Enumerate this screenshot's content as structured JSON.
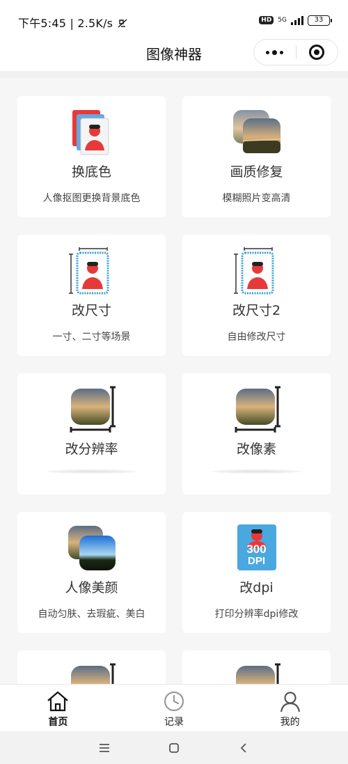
{
  "status_bar": {
    "time": "下午5:45",
    "speed": "2.5K/s",
    "hd": "HD",
    "network": "5G",
    "battery": "33"
  },
  "header": {
    "title": "图像神器"
  },
  "cards": [
    {
      "title": "换底色",
      "subtitle": "人像抠图更换背景底色",
      "icon": "id-photo-bg-icon"
    },
    {
      "title": "画质修复",
      "subtitle": "模糊照片变高清",
      "icon": "photo-restore-icon"
    },
    {
      "title": "改尺寸",
      "subtitle": "一寸、二寸等场景",
      "icon": "id-photo-resize-icon"
    },
    {
      "title": "改尺寸2",
      "subtitle": "自由修改尺寸",
      "icon": "id-photo-resize-icon"
    },
    {
      "title": "改分辨率",
      "subtitle": "",
      "icon": "photo-resolution-icon"
    },
    {
      "title": "改像素",
      "subtitle": "",
      "icon": "photo-pixels-icon"
    },
    {
      "title": "人像美颜",
      "subtitle": "自动匀肤、去瑕疵、美白",
      "icon": "beauty-icon"
    },
    {
      "title": "改dpi",
      "subtitle": "打印分辨率dpi修改",
      "icon": "dpi-icon"
    }
  ],
  "dpi_badge": {
    "number": "300",
    "unit": "DPI"
  },
  "tab_bar": {
    "home": "首页",
    "records": "记录",
    "mine": "我的"
  },
  "colors": {
    "accent_red": "#e63a3a",
    "frame_blue": "#3a9fd4",
    "dpi_blue": "#4aa8e0"
  }
}
